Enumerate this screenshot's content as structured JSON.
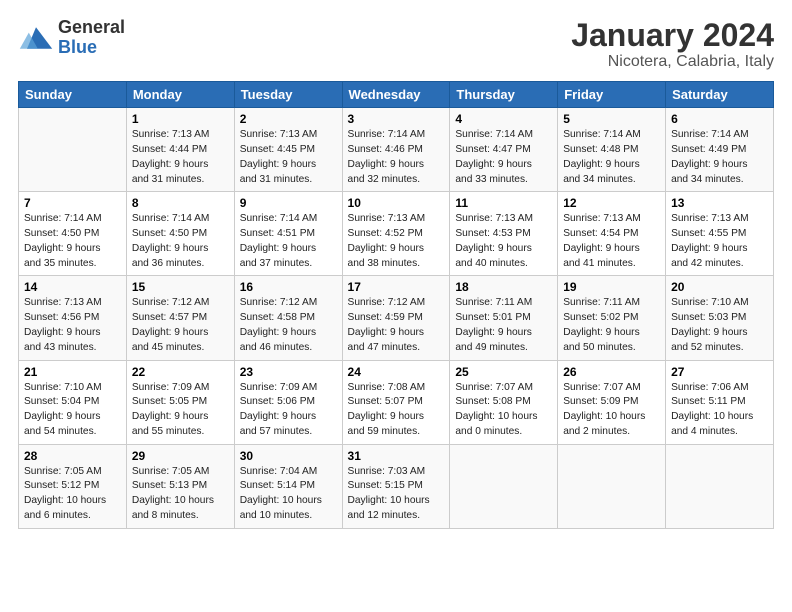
{
  "logo": {
    "general": "General",
    "blue": "Blue"
  },
  "title": "January 2024",
  "subtitle": "Nicotera, Calabria, Italy",
  "weekdays": [
    "Sunday",
    "Monday",
    "Tuesday",
    "Wednesday",
    "Thursday",
    "Friday",
    "Saturday"
  ],
  "weeks": [
    [
      {
        "day": "",
        "info": ""
      },
      {
        "day": "1",
        "info": "Sunrise: 7:13 AM\nSunset: 4:44 PM\nDaylight: 9 hours\nand 31 minutes."
      },
      {
        "day": "2",
        "info": "Sunrise: 7:13 AM\nSunset: 4:45 PM\nDaylight: 9 hours\nand 31 minutes."
      },
      {
        "day": "3",
        "info": "Sunrise: 7:14 AM\nSunset: 4:46 PM\nDaylight: 9 hours\nand 32 minutes."
      },
      {
        "day": "4",
        "info": "Sunrise: 7:14 AM\nSunset: 4:47 PM\nDaylight: 9 hours\nand 33 minutes."
      },
      {
        "day": "5",
        "info": "Sunrise: 7:14 AM\nSunset: 4:48 PM\nDaylight: 9 hours\nand 34 minutes."
      },
      {
        "day": "6",
        "info": "Sunrise: 7:14 AM\nSunset: 4:49 PM\nDaylight: 9 hours\nand 34 minutes."
      }
    ],
    [
      {
        "day": "7",
        "info": "Sunrise: 7:14 AM\nSunset: 4:50 PM\nDaylight: 9 hours\nand 35 minutes."
      },
      {
        "day": "8",
        "info": "Sunrise: 7:14 AM\nSunset: 4:50 PM\nDaylight: 9 hours\nand 36 minutes."
      },
      {
        "day": "9",
        "info": "Sunrise: 7:14 AM\nSunset: 4:51 PM\nDaylight: 9 hours\nand 37 minutes."
      },
      {
        "day": "10",
        "info": "Sunrise: 7:13 AM\nSunset: 4:52 PM\nDaylight: 9 hours\nand 38 minutes."
      },
      {
        "day": "11",
        "info": "Sunrise: 7:13 AM\nSunset: 4:53 PM\nDaylight: 9 hours\nand 40 minutes."
      },
      {
        "day": "12",
        "info": "Sunrise: 7:13 AM\nSunset: 4:54 PM\nDaylight: 9 hours\nand 41 minutes."
      },
      {
        "day": "13",
        "info": "Sunrise: 7:13 AM\nSunset: 4:55 PM\nDaylight: 9 hours\nand 42 minutes."
      }
    ],
    [
      {
        "day": "14",
        "info": "Sunrise: 7:13 AM\nSunset: 4:56 PM\nDaylight: 9 hours\nand 43 minutes."
      },
      {
        "day": "15",
        "info": "Sunrise: 7:12 AM\nSunset: 4:57 PM\nDaylight: 9 hours\nand 45 minutes."
      },
      {
        "day": "16",
        "info": "Sunrise: 7:12 AM\nSunset: 4:58 PM\nDaylight: 9 hours\nand 46 minutes."
      },
      {
        "day": "17",
        "info": "Sunrise: 7:12 AM\nSunset: 4:59 PM\nDaylight: 9 hours\nand 47 minutes."
      },
      {
        "day": "18",
        "info": "Sunrise: 7:11 AM\nSunset: 5:01 PM\nDaylight: 9 hours\nand 49 minutes."
      },
      {
        "day": "19",
        "info": "Sunrise: 7:11 AM\nSunset: 5:02 PM\nDaylight: 9 hours\nand 50 minutes."
      },
      {
        "day": "20",
        "info": "Sunrise: 7:10 AM\nSunset: 5:03 PM\nDaylight: 9 hours\nand 52 minutes."
      }
    ],
    [
      {
        "day": "21",
        "info": "Sunrise: 7:10 AM\nSunset: 5:04 PM\nDaylight: 9 hours\nand 54 minutes."
      },
      {
        "day": "22",
        "info": "Sunrise: 7:09 AM\nSunset: 5:05 PM\nDaylight: 9 hours\nand 55 minutes."
      },
      {
        "day": "23",
        "info": "Sunrise: 7:09 AM\nSunset: 5:06 PM\nDaylight: 9 hours\nand 57 minutes."
      },
      {
        "day": "24",
        "info": "Sunrise: 7:08 AM\nSunset: 5:07 PM\nDaylight: 9 hours\nand 59 minutes."
      },
      {
        "day": "25",
        "info": "Sunrise: 7:07 AM\nSunset: 5:08 PM\nDaylight: 10 hours\nand 0 minutes."
      },
      {
        "day": "26",
        "info": "Sunrise: 7:07 AM\nSunset: 5:09 PM\nDaylight: 10 hours\nand 2 minutes."
      },
      {
        "day": "27",
        "info": "Sunrise: 7:06 AM\nSunset: 5:11 PM\nDaylight: 10 hours\nand 4 minutes."
      }
    ],
    [
      {
        "day": "28",
        "info": "Sunrise: 7:05 AM\nSunset: 5:12 PM\nDaylight: 10 hours\nand 6 minutes."
      },
      {
        "day": "29",
        "info": "Sunrise: 7:05 AM\nSunset: 5:13 PM\nDaylight: 10 hours\nand 8 minutes."
      },
      {
        "day": "30",
        "info": "Sunrise: 7:04 AM\nSunset: 5:14 PM\nDaylight: 10 hours\nand 10 minutes."
      },
      {
        "day": "31",
        "info": "Sunrise: 7:03 AM\nSunset: 5:15 PM\nDaylight: 10 hours\nand 12 minutes."
      },
      {
        "day": "",
        "info": ""
      },
      {
        "day": "",
        "info": ""
      },
      {
        "day": "",
        "info": ""
      }
    ]
  ]
}
